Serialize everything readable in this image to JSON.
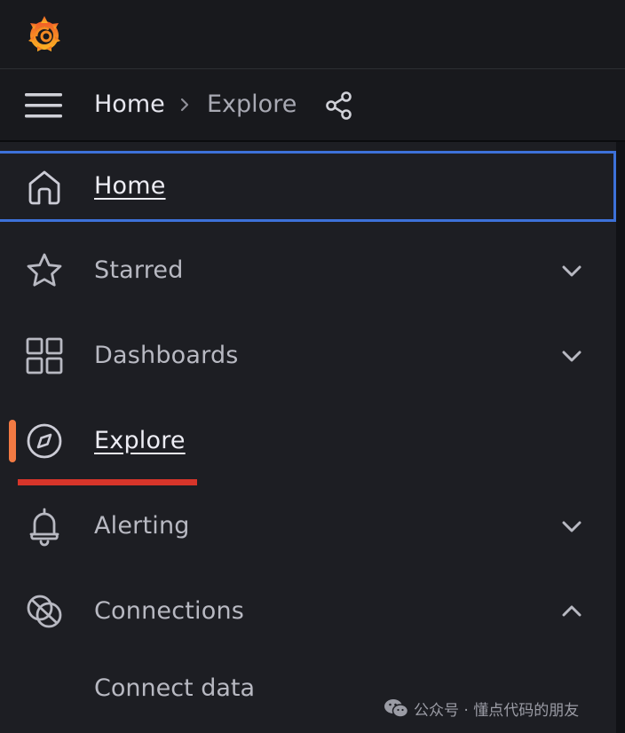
{
  "breadcrumb": {
    "home": "Home",
    "current": "Explore"
  },
  "menu": {
    "items": [
      {
        "label": "Home",
        "icon": "home-icon"
      },
      {
        "label": "Starred",
        "icon": "star-icon",
        "chevron": "down"
      },
      {
        "label": "Dashboards",
        "icon": "grid-icon",
        "chevron": "down"
      },
      {
        "label": "Explore",
        "icon": "compass-icon"
      },
      {
        "label": "Alerting",
        "icon": "bell-icon",
        "chevron": "down"
      },
      {
        "label": "Connections",
        "icon": "connections-icon",
        "chevron": "up"
      }
    ],
    "subitems": [
      {
        "label": "Connect data"
      }
    ]
  },
  "watermark": {
    "text": "公众号 · 懂点代码的朋友"
  },
  "colors": {
    "accent_active": "#f27a43",
    "focus_border": "#3d71d9",
    "annotation_red": "#d7352a"
  }
}
